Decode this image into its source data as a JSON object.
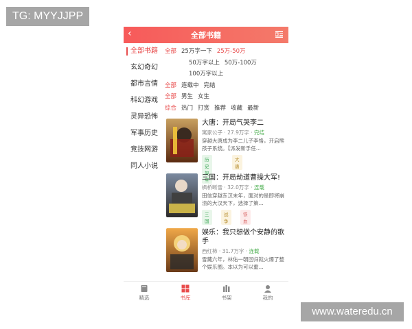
{
  "watermark_tl": "TG: MYYJJPP",
  "watermark_br": "www.wateredu.cn",
  "header": {
    "back_icon": "chevron-left-icon",
    "title": "全部书籍",
    "menu_icon": "category-list-icon"
  },
  "sidebar": {
    "items": [
      "全部书籍",
      "玄幻奇幻",
      "都市言情",
      "科幻游戏",
      "灵异恐怖",
      "军事历史",
      "竞技网游",
      "同人小说"
    ],
    "active_index": 0
  },
  "filters": {
    "words": [
      "全部",
      "25万字一下",
      "25万-50万",
      "50万字以上",
      "50万-100万",
      "100万字以上"
    ],
    "status": [
      "全部",
      "连载中",
      "完结"
    ],
    "gender": [
      "全部",
      "男生",
      "女生"
    ],
    "sort": [
      "综合",
      "热门",
      "打赏",
      "推荐",
      "收藏",
      "最新"
    ]
  },
  "books": [
    {
      "title": "大唐：开局气哭李二",
      "author": "寓家公子",
      "words": "27.9万字",
      "status": "完结",
      "desc": "穿越大唐成为李二儿子李恪，开启熊孩子系统。【派发新手任...",
      "tags": [
        "历史架空",
        "大唐"
      ]
    },
    {
      "title": "三国：开局劫道曹操大军!",
      "author": "枫桥断雪",
      "words": "32.0万字",
      "status": "连载",
      "desc": "田信穿越东汉末年，面对的是即将崩溃的大汉天下，选择了策...",
      "tags": [
        "三国",
        "战争",
        "铁血"
      ]
    },
    {
      "title": "娱乐：我只想做个安静的歌手",
      "author": "西红柿",
      "words": "31.7万字",
      "status": "连载",
      "desc": "雪藏六年，林佑一朝回归就火爆了整个娱乐圈。本以为可以重...",
      "tags": []
    }
  ],
  "tabbar": {
    "items": [
      {
        "label": "精选",
        "icon": "book-icon"
      },
      {
        "label": "书库",
        "icon": "library-grid-icon"
      },
      {
        "label": "书架",
        "icon": "bookshelf-icon"
      },
      {
        "label": "我的",
        "icon": "user-icon"
      }
    ],
    "active_index": 1
  },
  "colors": {
    "accent": "#e84c4c",
    "header_start": "#f75a5a",
    "header_end": "#f47a6a",
    "status_green": "#4caf50"
  }
}
